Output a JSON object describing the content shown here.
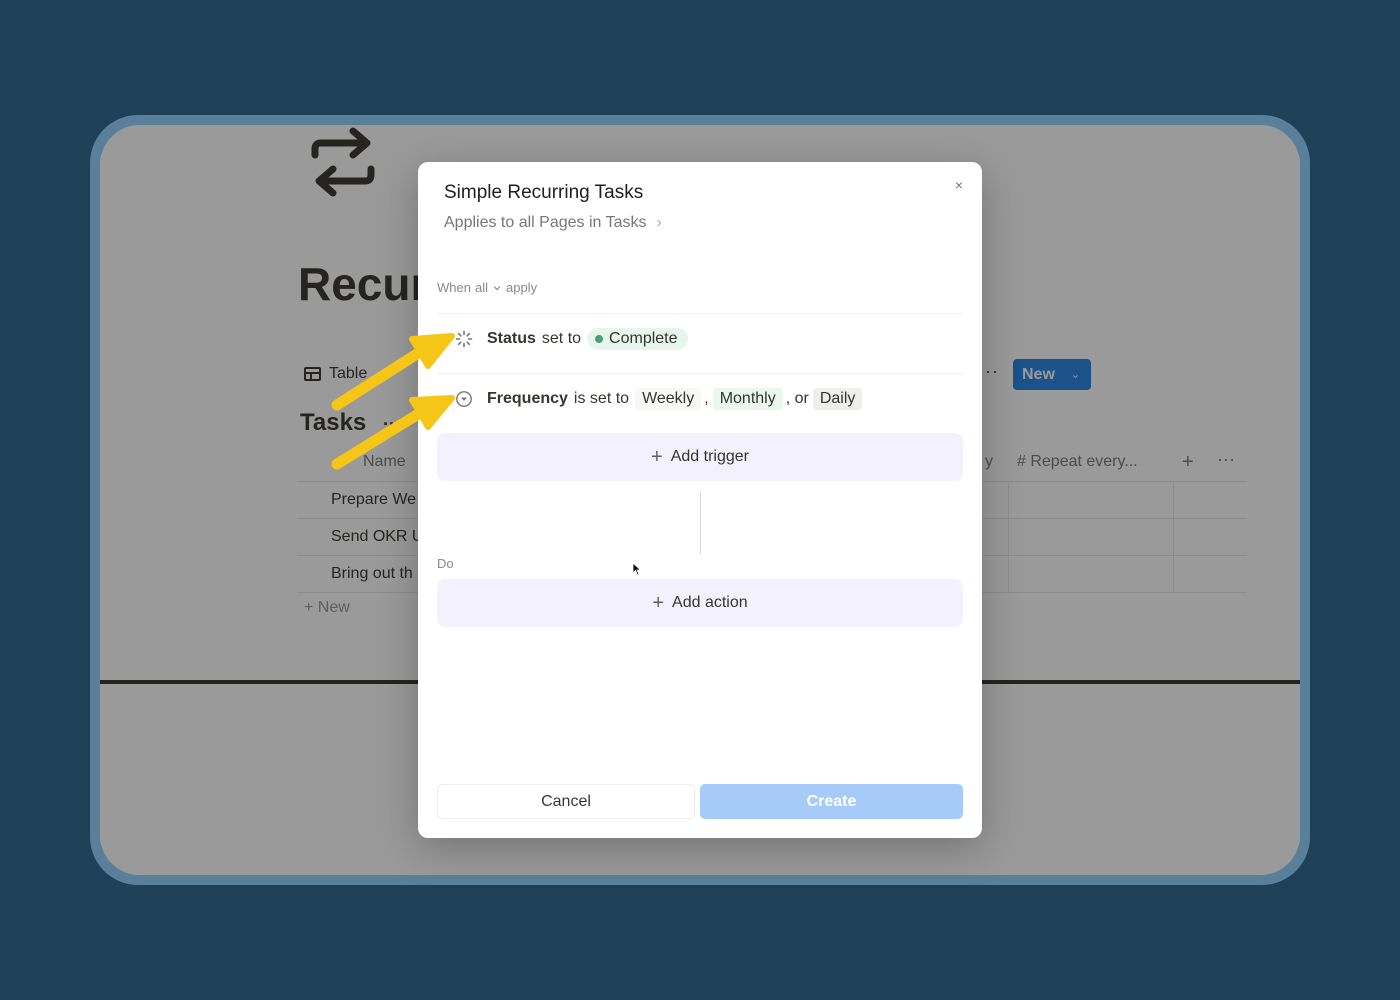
{
  "background_page": {
    "title": "Recur",
    "view_label": "Table",
    "more_dots": "···",
    "new_button": "New",
    "new_chevron": "⌄",
    "section_title": "Tasks",
    "section_dots": "··",
    "columns": {
      "name": "Name",
      "partial": "y",
      "repeat": "# Repeat every...",
      "add": "+",
      "more": "···"
    },
    "rows": [
      "Prepare We",
      "Send OKR U",
      "Bring out th"
    ],
    "new_row": "+ New"
  },
  "modal": {
    "title": "Simple Recurring Tasks",
    "subtitle": "Applies to all Pages in Tasks",
    "subtitle_arrow": "›",
    "close": "×",
    "when": {
      "prefix": "When",
      "mode": "all",
      "suffix": "apply"
    },
    "triggers": [
      {
        "property": "Status",
        "condition": "set to",
        "value": "Complete"
      },
      {
        "property": "Frequency",
        "condition": "is set to",
        "values": [
          "Weekly",
          "Monthly",
          "Daily"
        ],
        "sep1": ",",
        "sep2": ", or"
      }
    ],
    "add_trigger": "Add trigger",
    "do_label": "Do",
    "add_action": "Add action",
    "cancel": "Cancel",
    "create": "Create"
  },
  "colors": {
    "backdrop": "#1f4059",
    "annotation_arrow": "#f5c518",
    "primary_disabled": "#a7cbf8",
    "complete_dot": "#4c9f70"
  }
}
